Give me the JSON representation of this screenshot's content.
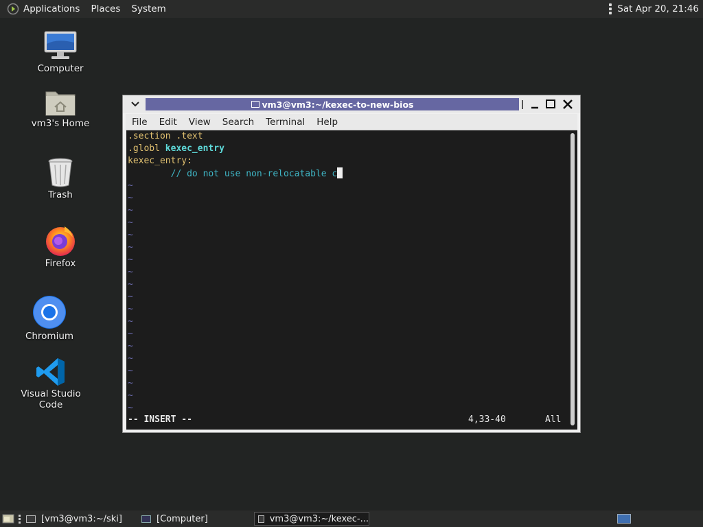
{
  "top_panel": {
    "menu": [
      "Applications",
      "Places",
      "System"
    ],
    "clock": "Sat Apr 20, 21:46"
  },
  "desktop": {
    "icons": [
      {
        "label": "Computer"
      },
      {
        "label": "vm3's Home"
      },
      {
        "label": "Trash"
      },
      {
        "label": "Firefox"
      },
      {
        "label": "Chromium"
      },
      {
        "label": "Visual Studio Code"
      }
    ]
  },
  "window": {
    "title": "vm3@vm3:~/kexec-to-new-bios",
    "menu": [
      "File",
      "Edit",
      "View",
      "Search",
      "Terminal",
      "Help"
    ],
    "editor": {
      "lines": [
        {
          "kw": ".section",
          "rest": " .text"
        },
        {
          "kw": ".globl",
          "sym": "kexec_entry"
        },
        {
          "label": "kexec_entry:"
        },
        {
          "indent": "        ",
          "comment": "// do not use non-relocatable c"
        }
      ],
      "tilde": "~",
      "mode": "-- INSERT --",
      "position": "4,33-40",
      "scroll": "All"
    }
  },
  "taskbar": {
    "tasks": [
      "[vm3@vm3:~/ski]",
      "[Computer]",
      "vm3@vm3:~/kexec-..."
    ]
  },
  "colors": {
    "title_active": "#6667a2",
    "terminal_bg": "#1c1c1c",
    "tilde": "#6c6cb0",
    "keyword": "#e0c070",
    "symbol": "#5ed8d8"
  }
}
